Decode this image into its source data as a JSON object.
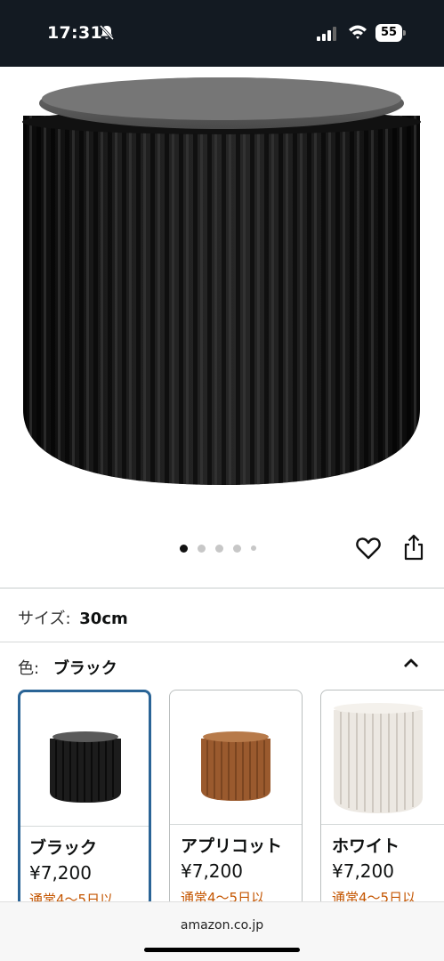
{
  "status_bar": {
    "time": "17:31",
    "battery": "55",
    "icons": [
      "bell-off-icon",
      "signal-icon",
      "wifi-icon",
      "battery-icon"
    ]
  },
  "product_image": {
    "subject": "black pleated paper stool with grey round seat",
    "carousel": {
      "total": 5,
      "active": 1
    }
  },
  "actions": {
    "icons": [
      "heart-icon",
      "share-icon"
    ]
  },
  "size": {
    "label": "サイズ:",
    "value": "30cm"
  },
  "color": {
    "label": "色:",
    "value": "ブラック"
  },
  "swatches": [
    {
      "name": "ブラック",
      "price": "¥7,200",
      "shipping": "通常4〜5日以",
      "color": "#1c1c1c",
      "selected": true
    },
    {
      "name": "アプリコット",
      "price": "¥7,200",
      "shipping": "通常4〜5日以",
      "color": "#9a5a2e",
      "selected": false
    },
    {
      "name": "ホワイト",
      "price": "¥7,200",
      "shipping": "通常4〜5日以",
      "color": "#ece8e2",
      "selected": false
    }
  ],
  "browser": {
    "url": "amazon.co.jp"
  },
  "colors": {
    "accent_border": "#2a6496",
    "shipping_text": "#c45500",
    "status_bar_bg": "#131a22"
  }
}
